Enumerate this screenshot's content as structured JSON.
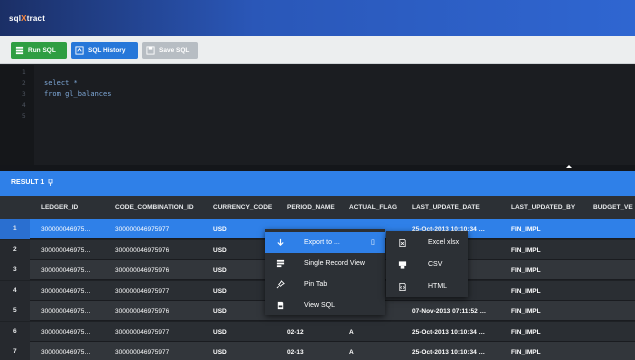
{
  "app": {
    "logo_prefix": "sql",
    "logo_x": "X",
    "logo_suffix": "tract"
  },
  "toolbar": {
    "run_label": "Run SQL",
    "history_label": "SQL History",
    "save_label": "Save SQL"
  },
  "editor": {
    "line_numbers": [
      "1",
      "2",
      "3",
      "4",
      "5"
    ],
    "lines": [
      "",
      "select *",
      "from gl_balances",
      "",
      ""
    ]
  },
  "results": {
    "tab_label": "RESULT 1",
    "columns": [
      "LEDGER_ID",
      "CODE_COMBINATION_ID",
      "CURRENCY_CODE",
      "PERIOD_NAME",
      "ACTUAL_FLAG",
      "LAST_UPDATE_DATE",
      "LAST_UPDATED_BY",
      "BUDGET_VE"
    ],
    "rows": [
      {
        "num": "1",
        "cells": [
          "300000046975…",
          "300000046975977",
          "USD",
          "",
          "",
          "25-Oct-2013 10:10:34 …",
          "FIN_IMPL",
          ""
        ]
      },
      {
        "num": "2",
        "cells": [
          "300000046975…",
          "300000046975976",
          "USD",
          "",
          "",
          "…1:52 …",
          "FIN_IMPL",
          ""
        ]
      },
      {
        "num": "3",
        "cells": [
          "300000046975…",
          "300000046975976",
          "USD",
          "",
          "",
          "…1:52 …",
          "FIN_IMPL",
          ""
        ]
      },
      {
        "num": "4",
        "cells": [
          "300000046975…",
          "300000046975977",
          "USD",
          "",
          "",
          "…0:34 …",
          "FIN_IMPL",
          ""
        ]
      },
      {
        "num": "5",
        "cells": [
          "300000046975…",
          "300000046975976",
          "USD",
          "12-12",
          "A",
          "07-Nov-2013 07:11:52 …",
          "FIN_IMPL",
          ""
        ]
      },
      {
        "num": "6",
        "cells": [
          "300000046975…",
          "300000046975977",
          "USD",
          "02-12",
          "A",
          "25-Oct-2013 10:10:34 …",
          "FIN_IMPL",
          ""
        ]
      },
      {
        "num": "7",
        "cells": [
          "300000046975…",
          "300000046975977",
          "USD",
          "02-13",
          "A",
          "25-Oct-2013 10:10:34 …",
          "FIN_IMPL",
          ""
        ]
      }
    ]
  },
  "context_menu": {
    "items": [
      {
        "label": "Export to ...",
        "icon": "arrow-down-icon",
        "active": true
      },
      {
        "label": "Single Record View",
        "icon": "record-view-icon"
      },
      {
        "label": "Pin Tab",
        "icon": "pin-icon"
      },
      {
        "label": "View SQL",
        "icon": "sql-file-icon"
      }
    ],
    "submenu": [
      {
        "label": "Excel xlsx",
        "icon": "excel-file-icon"
      },
      {
        "label": "CSV",
        "icon": "csv-icon"
      },
      {
        "label": "HTML",
        "icon": "html-file-icon"
      }
    ]
  },
  "colors": {
    "topbar": "#2a57b8",
    "run": "#2f9e42",
    "history": "#2677d9",
    "save": "#b7bdc3",
    "accent": "#2f80e8",
    "row_selected": "#2f80e8",
    "row_even": "#32363b",
    "row_odd": "#2a2e33"
  }
}
